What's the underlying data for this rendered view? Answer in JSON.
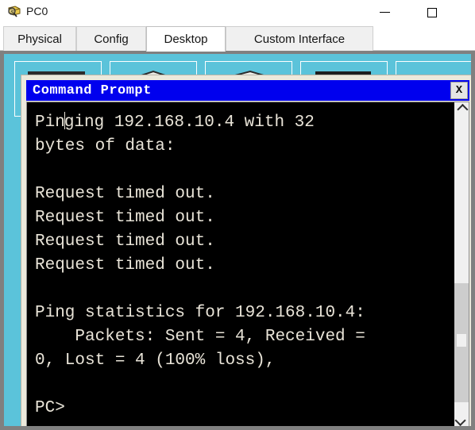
{
  "window": {
    "title": "PC0",
    "icon": "packet-tracer-pc-icon",
    "minimize_label": "—",
    "maximize_label": "□"
  },
  "tabs": [
    {
      "label": "Physical",
      "active": false
    },
    {
      "label": "Config",
      "active": false
    },
    {
      "label": "Desktop",
      "active": true
    },
    {
      "label": "Custom Interface",
      "active": false
    }
  ],
  "desktop": {
    "background_color": "#5bc3da",
    "icons": [
      {
        "name": "desktop-icon-1"
      },
      {
        "name": "desktop-icon-2"
      },
      {
        "name": "desktop-icon-3"
      },
      {
        "name": "desktop-icon-4"
      },
      {
        "name": "desktop-icon-5"
      }
    ]
  },
  "command_prompt": {
    "title": "Command Prompt",
    "titlebar_color": "#0000ee",
    "close_label": "X",
    "terminal": {
      "background_color": "#000000",
      "text_color": "#e9e4d8",
      "lines": [
        {
          "text": "Pinging 192.168.10.4 with 32",
          "caret_after": 3
        },
        {
          "text": "bytes of data:"
        },
        {
          "text": ""
        },
        {
          "text": "Request timed out."
        },
        {
          "text": "Request timed out."
        },
        {
          "text": "Request timed out."
        },
        {
          "text": "Request timed out."
        },
        {
          "text": ""
        },
        {
          "text": "Ping statistics for 192.168.10.4:"
        },
        {
          "text": "    Packets: Sent = 4, Received ="
        },
        {
          "text": "0, Lost = 4 (100% loss),"
        },
        {
          "text": ""
        },
        {
          "text": "PC>"
        }
      ]
    },
    "scrollbar": {
      "up_arrow": "⌃",
      "down_arrow": "⌄"
    }
  }
}
